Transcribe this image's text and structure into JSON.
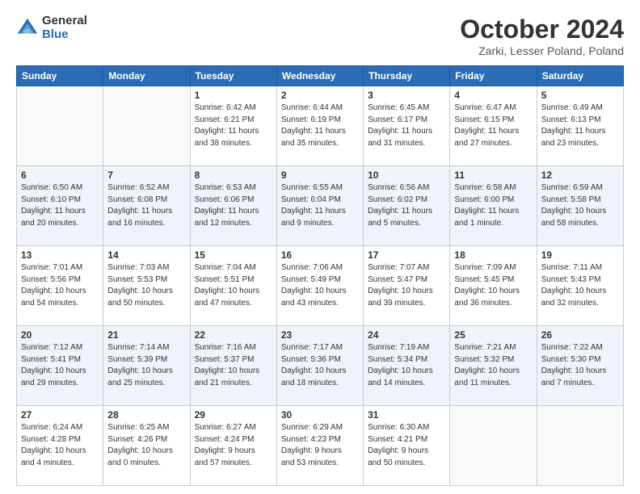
{
  "logo": {
    "general": "General",
    "blue": "Blue"
  },
  "header": {
    "title": "October 2024",
    "subtitle": "Zarki, Lesser Poland, Poland"
  },
  "weekdays": [
    "Sunday",
    "Monday",
    "Tuesday",
    "Wednesday",
    "Thursday",
    "Friday",
    "Saturday"
  ],
  "rows": [
    [
      {
        "day": "",
        "info": ""
      },
      {
        "day": "",
        "info": ""
      },
      {
        "day": "1",
        "info": "Sunrise: 6:42 AM\nSunset: 6:21 PM\nDaylight: 11 hours\nand 38 minutes."
      },
      {
        "day": "2",
        "info": "Sunrise: 6:44 AM\nSunset: 6:19 PM\nDaylight: 11 hours\nand 35 minutes."
      },
      {
        "day": "3",
        "info": "Sunrise: 6:45 AM\nSunset: 6:17 PM\nDaylight: 11 hours\nand 31 minutes."
      },
      {
        "day": "4",
        "info": "Sunrise: 6:47 AM\nSunset: 6:15 PM\nDaylight: 11 hours\nand 27 minutes."
      },
      {
        "day": "5",
        "info": "Sunrise: 6:49 AM\nSunset: 6:13 PM\nDaylight: 11 hours\nand 23 minutes."
      }
    ],
    [
      {
        "day": "6",
        "info": "Sunrise: 6:50 AM\nSunset: 6:10 PM\nDaylight: 11 hours\nand 20 minutes."
      },
      {
        "day": "7",
        "info": "Sunrise: 6:52 AM\nSunset: 6:08 PM\nDaylight: 11 hours\nand 16 minutes."
      },
      {
        "day": "8",
        "info": "Sunrise: 6:53 AM\nSunset: 6:06 PM\nDaylight: 11 hours\nand 12 minutes."
      },
      {
        "day": "9",
        "info": "Sunrise: 6:55 AM\nSunset: 6:04 PM\nDaylight: 11 hours\nand 9 minutes."
      },
      {
        "day": "10",
        "info": "Sunrise: 6:56 AM\nSunset: 6:02 PM\nDaylight: 11 hours\nand 5 minutes."
      },
      {
        "day": "11",
        "info": "Sunrise: 6:58 AM\nSunset: 6:00 PM\nDaylight: 11 hours\nand 1 minute."
      },
      {
        "day": "12",
        "info": "Sunrise: 6:59 AM\nSunset: 5:58 PM\nDaylight: 10 hours\nand 58 minutes."
      }
    ],
    [
      {
        "day": "13",
        "info": "Sunrise: 7:01 AM\nSunset: 5:56 PM\nDaylight: 10 hours\nand 54 minutes."
      },
      {
        "day": "14",
        "info": "Sunrise: 7:03 AM\nSunset: 5:53 PM\nDaylight: 10 hours\nand 50 minutes."
      },
      {
        "day": "15",
        "info": "Sunrise: 7:04 AM\nSunset: 5:51 PM\nDaylight: 10 hours\nand 47 minutes."
      },
      {
        "day": "16",
        "info": "Sunrise: 7:06 AM\nSunset: 5:49 PM\nDaylight: 10 hours\nand 43 minutes."
      },
      {
        "day": "17",
        "info": "Sunrise: 7:07 AM\nSunset: 5:47 PM\nDaylight: 10 hours\nand 39 minutes."
      },
      {
        "day": "18",
        "info": "Sunrise: 7:09 AM\nSunset: 5:45 PM\nDaylight: 10 hours\nand 36 minutes."
      },
      {
        "day": "19",
        "info": "Sunrise: 7:11 AM\nSunset: 5:43 PM\nDaylight: 10 hours\nand 32 minutes."
      }
    ],
    [
      {
        "day": "20",
        "info": "Sunrise: 7:12 AM\nSunset: 5:41 PM\nDaylight: 10 hours\nand 29 minutes."
      },
      {
        "day": "21",
        "info": "Sunrise: 7:14 AM\nSunset: 5:39 PM\nDaylight: 10 hours\nand 25 minutes."
      },
      {
        "day": "22",
        "info": "Sunrise: 7:16 AM\nSunset: 5:37 PM\nDaylight: 10 hours\nand 21 minutes."
      },
      {
        "day": "23",
        "info": "Sunrise: 7:17 AM\nSunset: 5:36 PM\nDaylight: 10 hours\nand 18 minutes."
      },
      {
        "day": "24",
        "info": "Sunrise: 7:19 AM\nSunset: 5:34 PM\nDaylight: 10 hours\nand 14 minutes."
      },
      {
        "day": "25",
        "info": "Sunrise: 7:21 AM\nSunset: 5:32 PM\nDaylight: 10 hours\nand 11 minutes."
      },
      {
        "day": "26",
        "info": "Sunrise: 7:22 AM\nSunset: 5:30 PM\nDaylight: 10 hours\nand 7 minutes."
      }
    ],
    [
      {
        "day": "27",
        "info": "Sunrise: 6:24 AM\nSunset: 4:28 PM\nDaylight: 10 hours\nand 4 minutes."
      },
      {
        "day": "28",
        "info": "Sunrise: 6:25 AM\nSunset: 4:26 PM\nDaylight: 10 hours\nand 0 minutes."
      },
      {
        "day": "29",
        "info": "Sunrise: 6:27 AM\nSunset: 4:24 PM\nDaylight: 9 hours\nand 57 minutes."
      },
      {
        "day": "30",
        "info": "Sunrise: 6:29 AM\nSunset: 4:23 PM\nDaylight: 9 hours\nand 53 minutes."
      },
      {
        "day": "31",
        "info": "Sunrise: 6:30 AM\nSunset: 4:21 PM\nDaylight: 9 hours\nand 50 minutes."
      },
      {
        "day": "",
        "info": ""
      },
      {
        "day": "",
        "info": ""
      }
    ]
  ]
}
